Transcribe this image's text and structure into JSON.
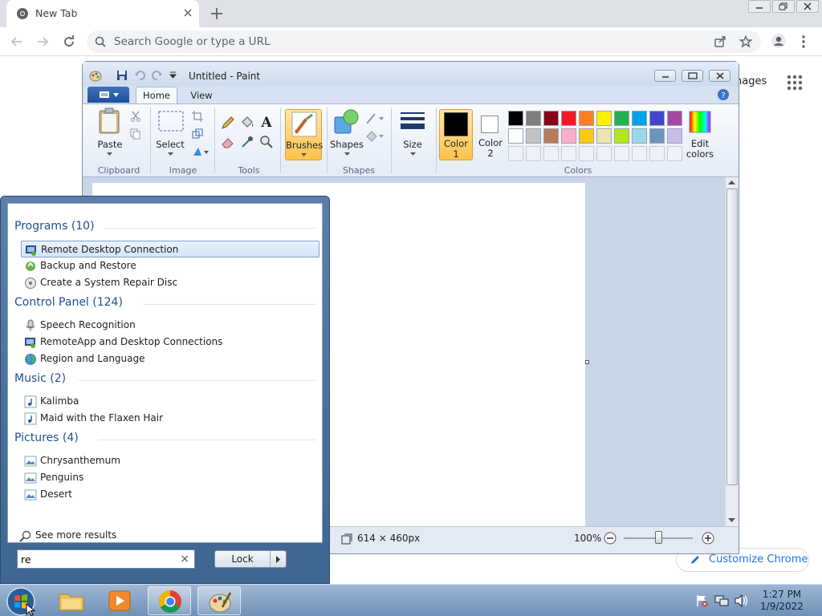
{
  "chrome": {
    "tab_title": "New Tab",
    "omnibox_placeholder": "Search Google or type a URL",
    "ntp_images_link": "nages",
    "customize_label": "Customize Chrome"
  },
  "paint": {
    "window_title": "Untitled - Paint",
    "tabs": {
      "home": "Home",
      "view": "View"
    },
    "ribbon": {
      "paste": "Paste",
      "select": "Select",
      "brushes": "Brushes",
      "shapes": "Shapes",
      "size": "Size",
      "color1_a": "Color",
      "color1_b": "1",
      "color2_a": "Color",
      "color2_b": "2",
      "edit_colors_a": "Edit",
      "edit_colors_b": "colors",
      "groups": {
        "clipboard": "Clipboard",
        "image": "Image",
        "tools": "Tools",
        "shapes": "Shapes",
        "colors": "Colors"
      }
    },
    "palette_row1": [
      "#000000",
      "#7f7f7f",
      "#880015",
      "#ed1c24",
      "#ff7f27",
      "#fff200",
      "#22b14c",
      "#00a2e8",
      "#3f48cc",
      "#a349a4"
    ],
    "palette_row2": [
      "#ffffff",
      "#c3c3c3",
      "#b97a57",
      "#ffaec9",
      "#ffc90e",
      "#efe4b0",
      "#b5e61d",
      "#99d9ea",
      "#7092be",
      "#c8bfe7"
    ],
    "status": {
      "canvas_size": "614 × 460px",
      "zoom": "100%"
    }
  },
  "start_menu": {
    "categories": [
      {
        "title": "Programs (10)",
        "items": [
          "Remote Desktop Connection",
          "Backup and Restore",
          "Create a System Repair Disc"
        ]
      },
      {
        "title": "Control Panel (124)",
        "items": [
          "Speech Recognition",
          "RemoteApp and Desktop Connections",
          "Region and Language"
        ]
      },
      {
        "title": "Music (2)",
        "items": [
          "Kalimba",
          "Maid with the Flaxen Hair"
        ]
      },
      {
        "title": "Pictures (4)",
        "items": [
          "Chrysanthemum",
          "Penguins",
          "Desert"
        ]
      }
    ],
    "see_more": "See more results",
    "search_value": "re",
    "lock_label": "Lock"
  },
  "taskbar": {
    "time": "1:27 PM",
    "date": "1/9/2022"
  }
}
